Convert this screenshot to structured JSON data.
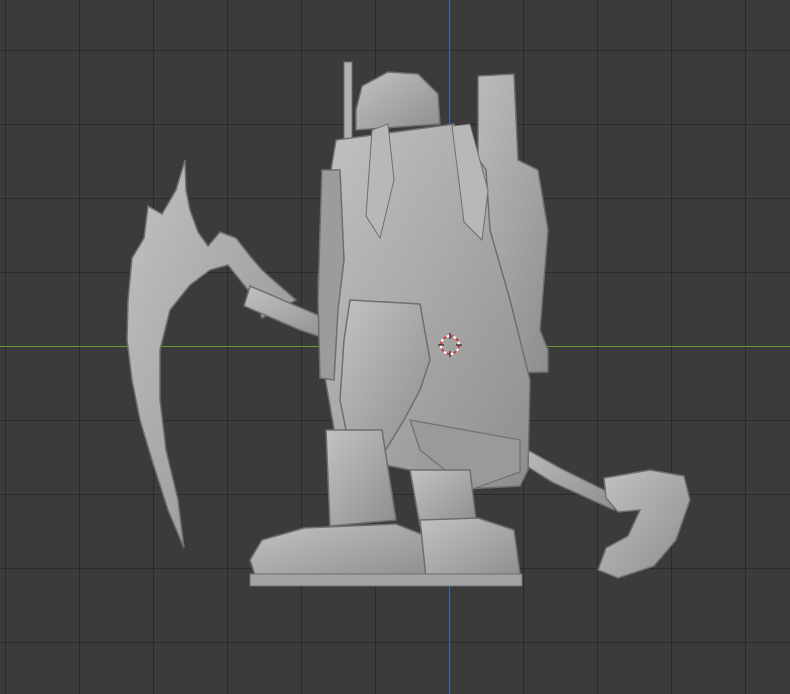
{
  "viewport": {
    "background_color": "#3b3b3b",
    "grid_color": "rgba(0,0,0,0.28)",
    "x_axis_color": "#6a9a2f",
    "z_axis_color": "#2f6fb8"
  },
  "model": {
    "description_icon": "sculpt-mesh-dwarf-warrior",
    "mesh_color": "#a9a9a9",
    "mesh_shadow": "#7c7c7c",
    "mesh_highlight": "#c9c9c9"
  },
  "cursor": {
    "icon": "3d-cursor-icon",
    "color_a": "#d23a3a",
    "color_b": "#ffffff"
  }
}
